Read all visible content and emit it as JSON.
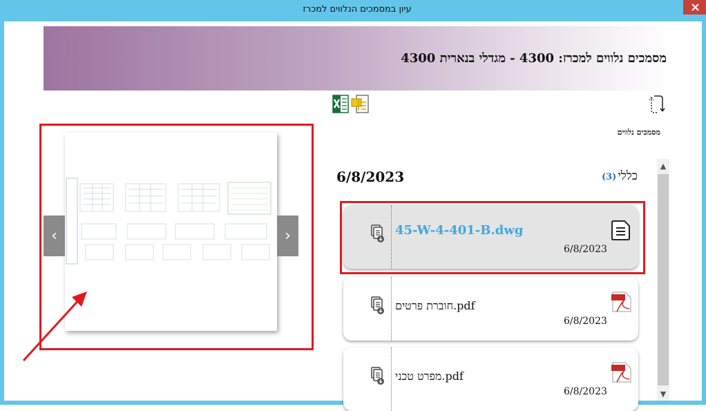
{
  "window": {
    "title": "עיון במסמכים הנלווים למכרז"
  },
  "banner": {
    "title": "מסמכים נלווים למכרז: 4300 - מגדלי בנארית 4300"
  },
  "toolbar": {
    "excel_icon": "excel-icon",
    "docs_icon": "documents-icon",
    "refresh_icon": "refresh-icon"
  },
  "section": {
    "label": "מסמכים נלווים"
  },
  "group": {
    "name": "כללי",
    "count": "(3)",
    "date": "6/8/2023"
  },
  "documents": [
    {
      "name": "45-W-4-401-B.dwg",
      "date": "6/8/2023",
      "type": "dwg",
      "selected": true
    },
    {
      "name": "חוברת פרטים.pdf",
      "date": "6/8/2023",
      "type": "pdf",
      "selected": false
    },
    {
      "name": "מפרט טכני.pdf",
      "date": "6/8/2023",
      "type": "pdf",
      "selected": false
    }
  ],
  "preview": {
    "prev": "‹",
    "next": "›"
  },
  "colors": {
    "titlebar": "#63c5ea",
    "close": "#c7413a",
    "highlight": "#e0191f",
    "link": "#3fa7dd"
  }
}
